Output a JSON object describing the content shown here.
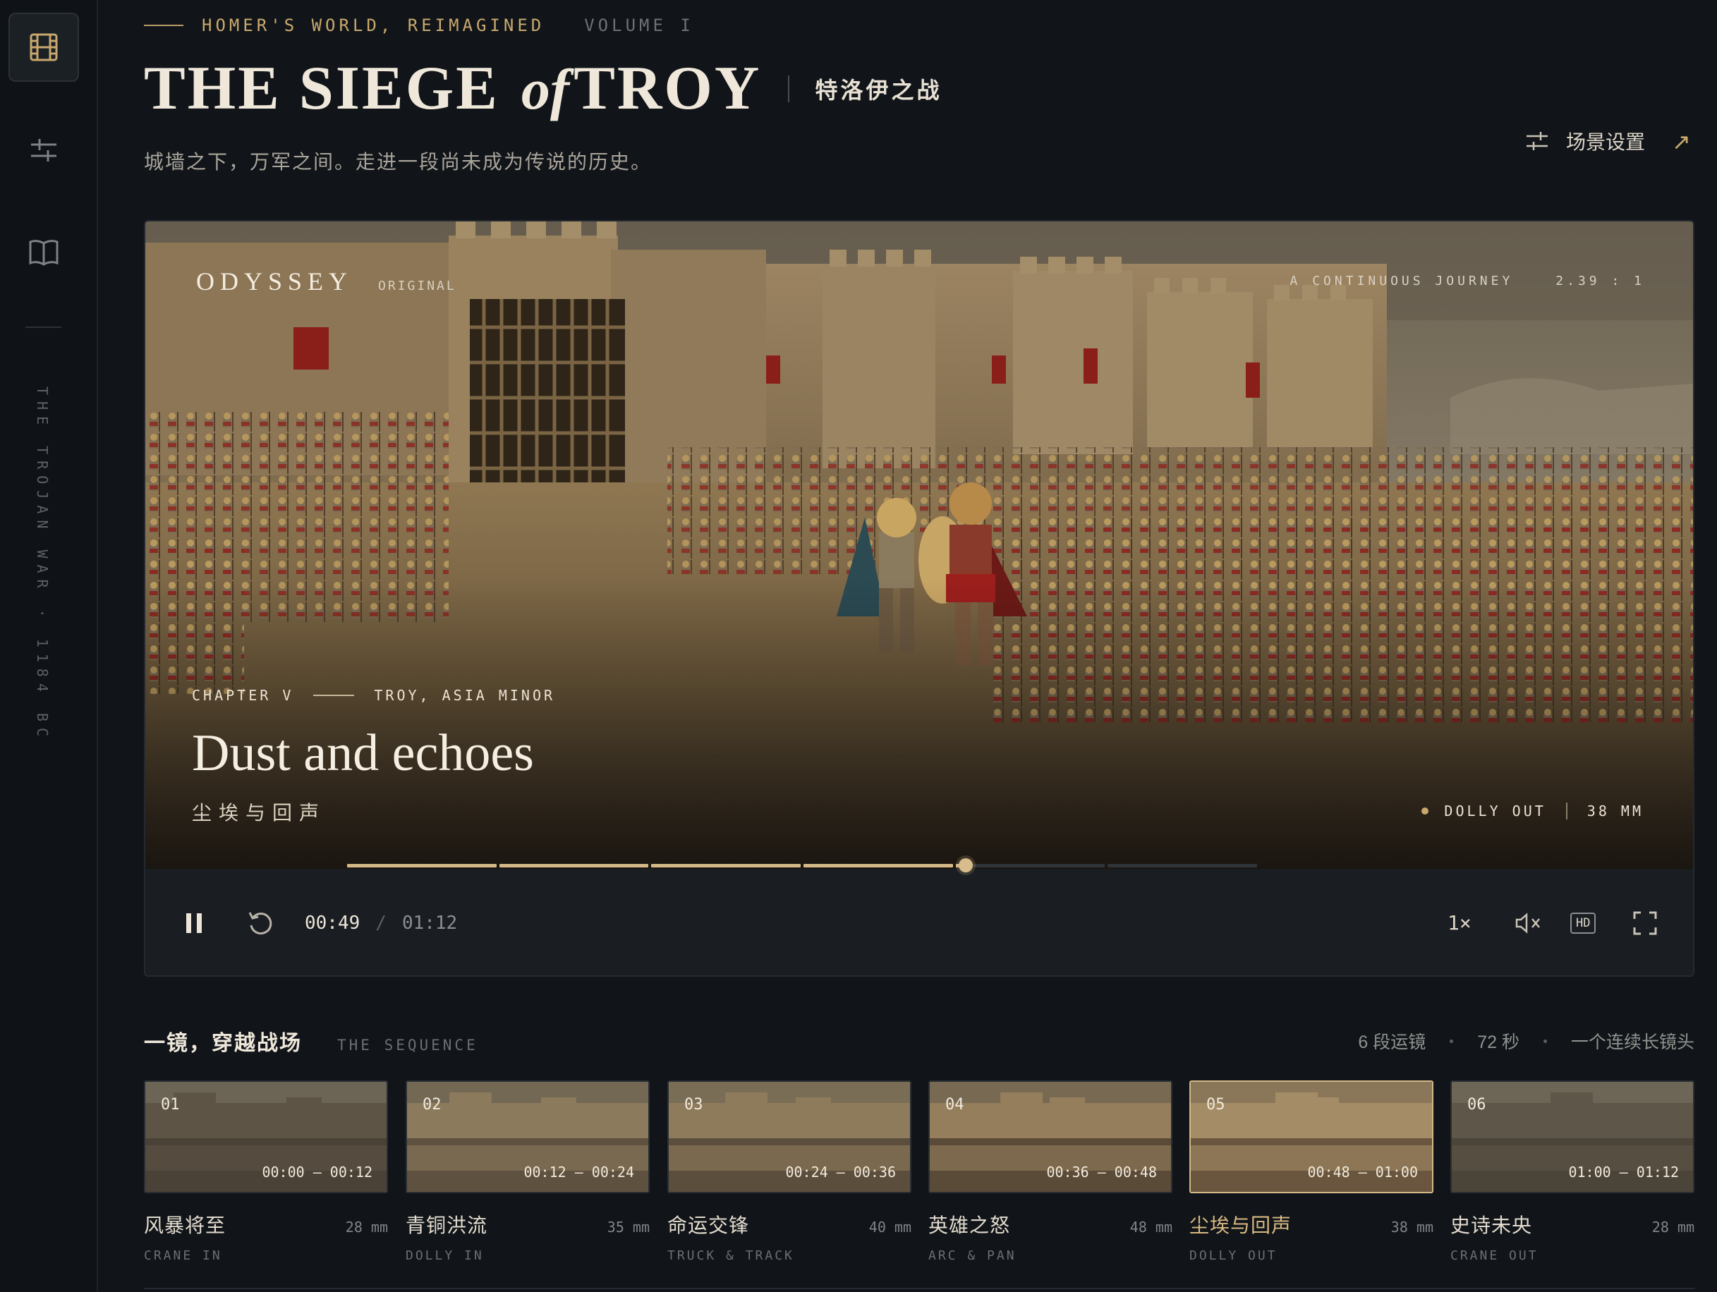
{
  "sidebar": {
    "items": [
      {
        "name": "film",
        "icon": "film-icon"
      },
      {
        "name": "settings",
        "icon": "sliders-icon"
      },
      {
        "name": "book",
        "icon": "book-icon"
      }
    ],
    "vertical_text": "THE TROJAN WAR · 1184 BC"
  },
  "header": {
    "kicker": "HOMER'S WORLD, REIMAGINED",
    "volume": "VOLUME I",
    "title_pre": "THE SIEGE ",
    "title_of": "of",
    "title_post": "TROY",
    "title_cn": "特洛伊之战",
    "subtitle": "城墙之下，万军之间。走进一段尚未成为传说的历史。",
    "scene_settings_label": "场景设置",
    "external_link": "↗"
  },
  "player": {
    "brand": "ODYSSEY",
    "brand_tag": "ORIGINAL",
    "journey_label": "A CONTINUOUS JOURNEY",
    "aspect_ratio": "2.39 : 1",
    "chapter": "CHAPTER V",
    "location": "TROY, ASIA MINOR",
    "scene_title": "Dust and echoes",
    "scene_title_cn": "尘埃与回声",
    "camera_move": "DOLLY OUT",
    "focal_length": "38 MM",
    "controls": {
      "current_time": "00:49",
      "separator": "/",
      "total_time": "01:12",
      "progress": 0.68,
      "speed": "1×",
      "quality": "HD"
    }
  },
  "sequence": {
    "title": "一镜，穿越战场",
    "subtitle": "THE SEQUENCE",
    "stat_shots": "6 段运镜",
    "stat_seconds": "72 秒",
    "stat_take": "一个连续长镜头",
    "shots": [
      {
        "num": "01",
        "time": "00:00 – 00:12",
        "name": "风暴将至",
        "mm": "28 mm",
        "move": "CRANE IN"
      },
      {
        "num": "02",
        "time": "00:12 – 00:24",
        "name": "青铜洪流",
        "mm": "35 mm",
        "move": "DOLLY IN"
      },
      {
        "num": "03",
        "time": "00:24 – 00:36",
        "name": "命运交锋",
        "mm": "40 mm",
        "move": "TRUCK & TRACK"
      },
      {
        "num": "04",
        "time": "00:36 – 00:48",
        "name": "英雄之怒",
        "mm": "48 mm",
        "move": "ARC & PAN"
      },
      {
        "num": "05",
        "time": "00:48 – 01:00",
        "name": "尘埃与回声",
        "mm": "38 mm",
        "move": "DOLLY OUT"
      },
      {
        "num": "06",
        "time": "01:00 – 01:12",
        "name": "史诗未央",
        "mm": "28 mm",
        "move": "CRANE OUT"
      }
    ],
    "active_index": 4
  },
  "colors": {
    "accent": "#c9a86e",
    "background": "#111519",
    "progress_fill": "#d4b888"
  }
}
